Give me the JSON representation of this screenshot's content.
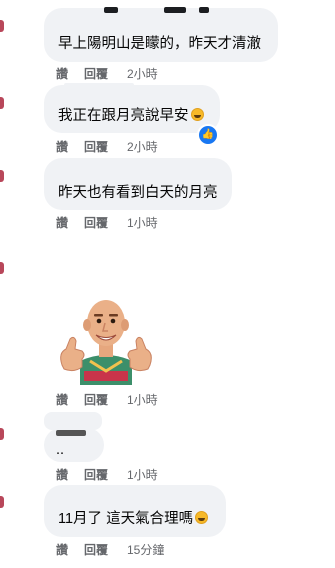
{
  "comments": [
    {
      "text": "早上陽明山是矇的，昨天才清澈",
      "actions": {
        "like": "讚",
        "reply": "回覆",
        "time": "2小時"
      }
    },
    {
      "text": "我正在跟月亮說早安",
      "actions": {
        "like": "讚",
        "reply": "回覆",
        "time": "2小時"
      },
      "reaction_icon": "thumbs-up-icon"
    },
    {
      "text": "昨天也有看到白天的月亮",
      "actions": {
        "like": "讚",
        "reply": "回覆",
        "time": "1小時"
      }
    },
    {
      "sticker": "thumbs-up-avatar-sticker",
      "actions": {
        "like": "讚",
        "reply": "回覆",
        "time": "1小時"
      }
    },
    {
      "text": "..",
      "actions": {
        "like": "讚",
        "reply": "回覆",
        "time": "1小時"
      }
    },
    {
      "text": "11月了 這天氣合理嗎",
      "actions": {
        "like": "讚",
        "reply": "回覆",
        "time": "15分鐘"
      }
    }
  ],
  "colors": {
    "bubble": "#f0f2f5",
    "meta_text": "#65676b",
    "like_badge": "#1877f2",
    "avatar_edge": "#b8475a"
  }
}
